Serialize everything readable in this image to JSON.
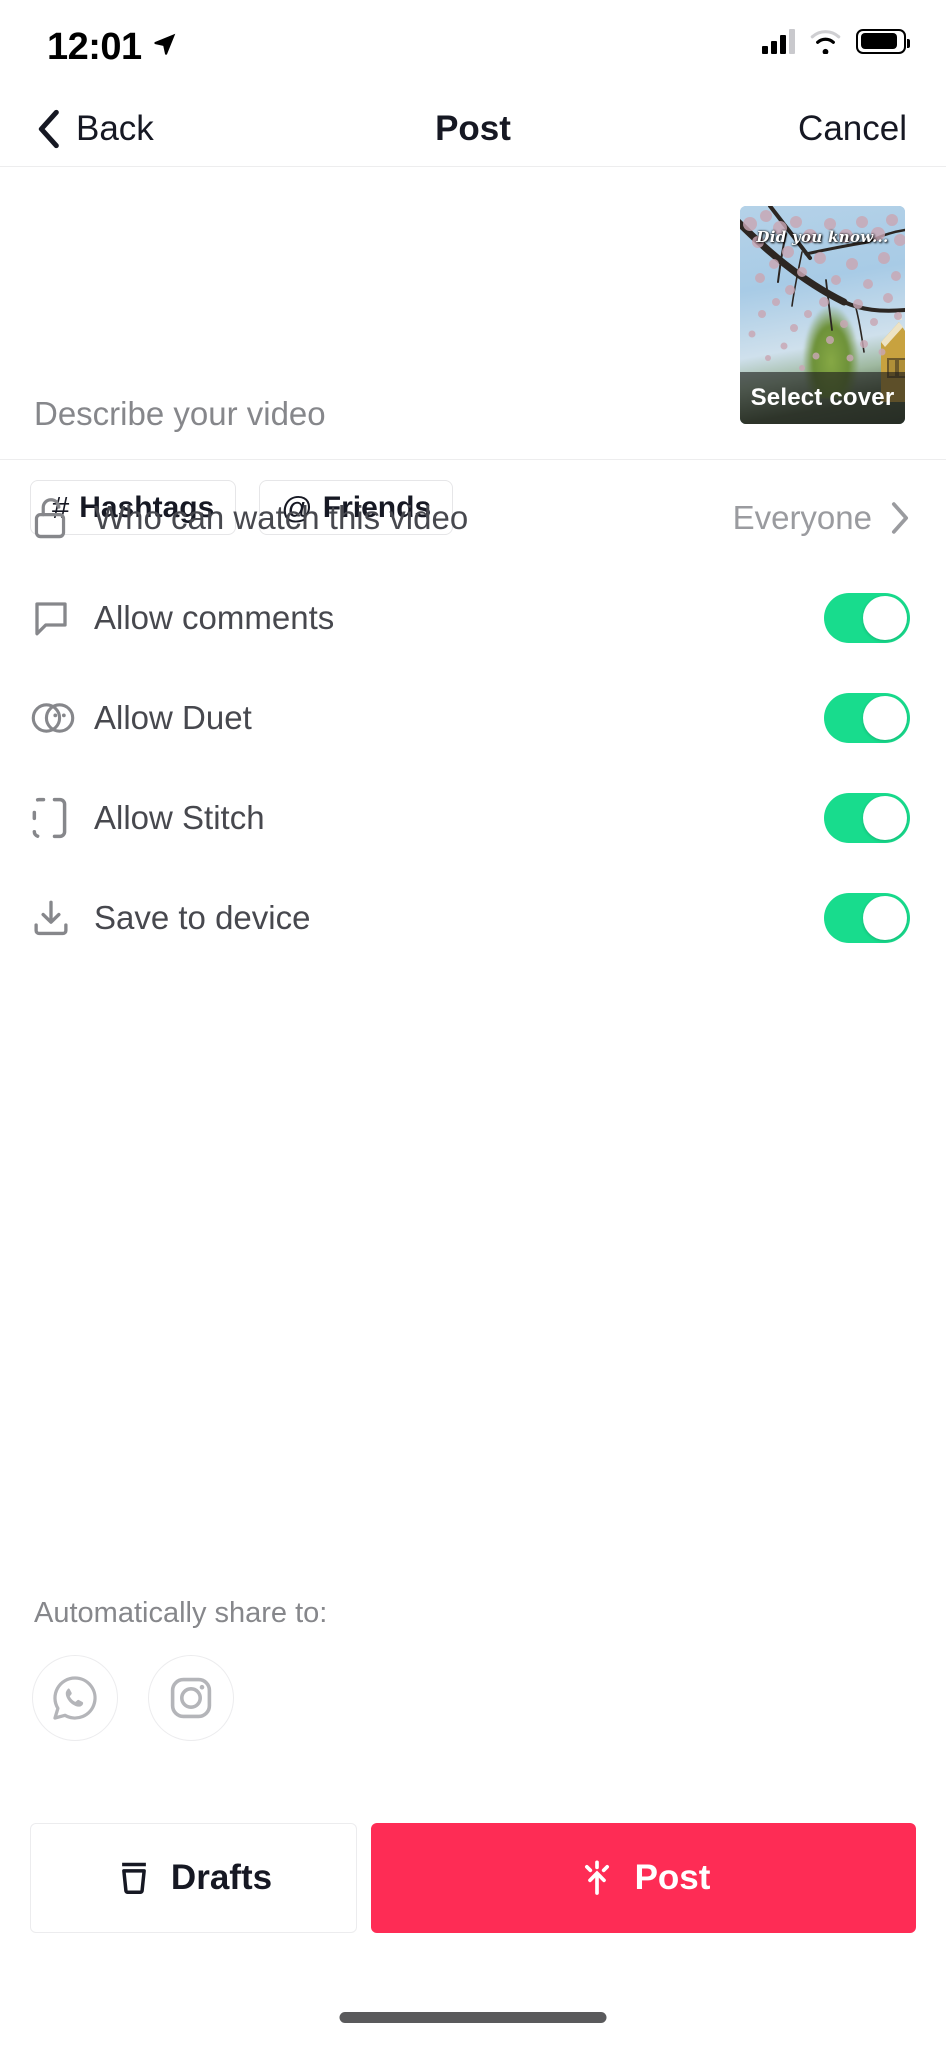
{
  "status_bar": {
    "time": "12:01",
    "location_icon": "location-arrow-icon",
    "signal_icon": "cellular-signal-icon",
    "wifi_icon": "wifi-icon",
    "battery_icon": "battery-icon"
  },
  "nav": {
    "back_label": "Back",
    "back_icon": "chevron-left-icon",
    "title": "Post",
    "cancel_label": "Cancel"
  },
  "description": {
    "placeholder": "Describe your video",
    "value": "",
    "chips": [
      {
        "glyph": "#",
        "label": "Hashtags",
        "icon": "hashtag-icon"
      },
      {
        "glyph": "@",
        "label": "Friends",
        "icon": "at-mention-icon"
      }
    ]
  },
  "cover": {
    "overlay_text": "Did you know...",
    "select_cover_label": "Select cover"
  },
  "settings": [
    {
      "id": "privacy",
      "label": "Who can watch this video",
      "icon": "unlock-icon",
      "control": "chevron",
      "value": "Everyone"
    },
    {
      "id": "comments",
      "label": "Allow comments",
      "icon": "comment-bubble-icon",
      "control": "toggle",
      "value": "on"
    },
    {
      "id": "duet",
      "label": "Allow Duet",
      "icon": "duet-icon",
      "control": "toggle",
      "value": "on"
    },
    {
      "id": "stitch",
      "label": "Allow Stitch",
      "icon": "stitch-icon",
      "control": "toggle",
      "value": "on"
    },
    {
      "id": "save",
      "label": "Save to device",
      "icon": "download-icon",
      "control": "toggle",
      "value": "on"
    }
  ],
  "share": {
    "label": "Automatically share to:",
    "targets": [
      {
        "id": "whatsapp",
        "icon": "whatsapp-icon"
      },
      {
        "id": "instagram",
        "icon": "instagram-icon"
      }
    ]
  },
  "actions": {
    "drafts_label": "Drafts",
    "drafts_icon": "archive-box-icon",
    "post_label": "Post",
    "post_icon": "upload-spark-icon"
  },
  "colors": {
    "accent_red": "#fe2c55",
    "toggle_green": "#18dc8d",
    "text_primary": "#161823",
    "text_secondary": "#86878b"
  }
}
